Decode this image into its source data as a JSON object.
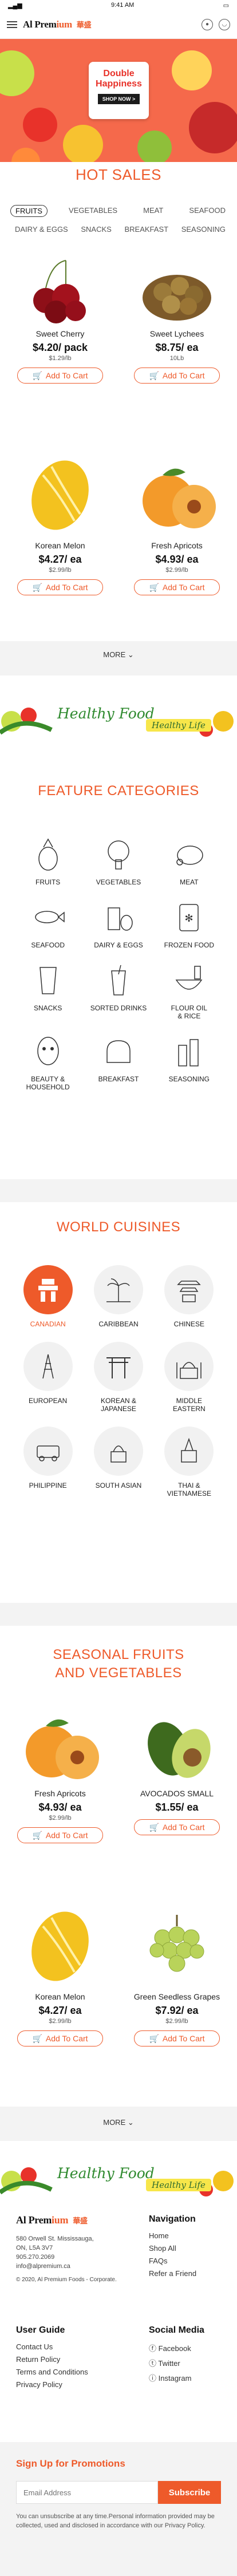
{
  "status": {
    "time": "9:41 AM"
  },
  "header": {
    "logo_main": "Al Prem",
    "logo_accent": "ium",
    "logo_cn": "華盛"
  },
  "banner": {
    "title": "Double Happiness",
    "button": "SHOP NOW >"
  },
  "hot_sales": {
    "title": "HOT SALES",
    "tabs": [
      "FRUITS",
      "VEGETABLES",
      "MEAT",
      "SEAFOOD",
      "DAIRY & EGGS",
      "SNACKS",
      "BREAKFAST",
      "SEASONING"
    ],
    "products": [
      {
        "name": "Sweet Cherry",
        "price": "$4.20/ pack",
        "unit": "$1.29/lb",
        "button": "Add To Cart"
      },
      {
        "name": "Sweet Lychees",
        "price": "$8.75/ ea",
        "unit": "10Lb",
        "button": "Add To Cart"
      },
      {
        "name": "Korean Melon",
        "price": "$4.27/ ea",
        "unit": "$2.99/lb",
        "button": "Add To Cart"
      },
      {
        "name": "Fresh Apricots",
        "price": "$4.93/ ea",
        "unit": "$2.99/lb",
        "button": "Add To Cart"
      }
    ],
    "more": "MORE"
  },
  "healthy": {
    "text": "Healthy Food",
    "tag": "Healthy Life"
  },
  "categories": {
    "title": "FEATURE CATEGORIES",
    "items": [
      "FRUITS",
      "VEGETABLES",
      "MEAT",
      "SEAFOOD",
      "DAIRY & EGGS",
      "FROZEN FOOD",
      "SNACKS",
      "SORTED DRINKS",
      "FLOUR OIL\n& RICE",
      "BEAUTY &\nHOUSEHOLD",
      "BREAKFAST",
      "SEASONING"
    ]
  },
  "cuisines": {
    "title": "WORLD CUISINES",
    "items": [
      "CANADIAN",
      "CARIBBEAN",
      "CHINESE",
      "EUROPEAN",
      "KOREAN &\nJAPANESE",
      "MIDDLE\nEASTERN",
      "PHILIPPINE",
      "SOUTH ASIAN",
      "THAI &\nVIETNAMESE"
    ]
  },
  "seasonal": {
    "title_line1": "SEASONAL FRUITS",
    "title_line2": "AND VEGETABLES",
    "products": [
      {
        "name": "Fresh Apricots",
        "price": "$4.93/ ea",
        "unit": "$2.99/lb",
        "button": "Add To Cart"
      },
      {
        "name": "AVOCADOS SMALL",
        "price": "$1.55/ ea",
        "unit": "",
        "button": "Add To Cart"
      },
      {
        "name": "Korean Melon",
        "price": "$4.27/ ea",
        "unit": "$2.99/lb",
        "button": "Add To Cart"
      },
      {
        "name": "Green Seedless Grapes",
        "price": "$7.92/ ea",
        "unit": "$2.99/lb",
        "button": "Add To Cart"
      }
    ],
    "more": "MORE"
  },
  "footer": {
    "address": [
      "580 Orwell St. Mississauga,",
      "ON, L5A 3V7",
      "905.270.2069",
      "info@alpremium.ca"
    ],
    "copyright": "© 2020, Al Premium Foods - Corporate.",
    "navigation": {
      "title": "Navigation",
      "links": [
        "Home",
        "Shop All",
        "FAQs",
        "Refer a Friend"
      ]
    },
    "user_guide": {
      "title": "User Guide",
      "links": [
        "Contact Us",
        "Return Policy",
        "Terms and Conditions",
        "Privacy Policy"
      ]
    },
    "social": {
      "title": "Social Media",
      "links": [
        "Facebook",
        "Twitter",
        "Instagram"
      ]
    }
  },
  "signup": {
    "title": "Sign Up for Promotions",
    "placeholder": "Email Address",
    "button": "Subscribe",
    "disclaimer": "You can unsubscribe at any time.Personal information provided may be collected, used and disclosed in accordance with our Privacy Policy."
  }
}
